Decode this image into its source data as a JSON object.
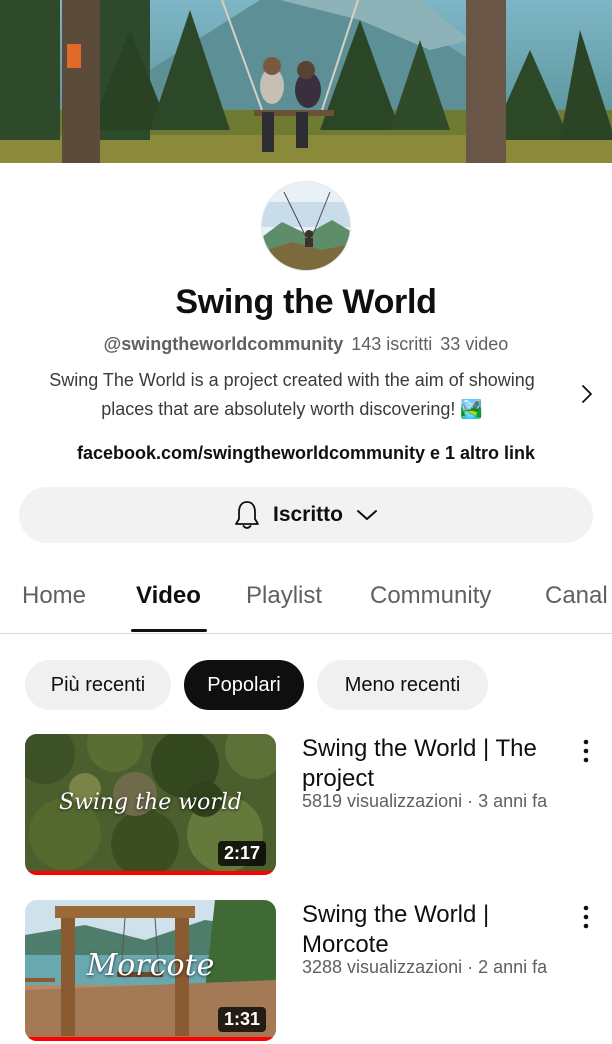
{
  "channel": {
    "name": "Swing the World",
    "handle": "@swingtheworldcommunity",
    "subscribers": "143 iscritti",
    "video_count": "33 video",
    "description_line1": "Swing The World is a project created with the aim of showing",
    "description_line2": "places that are absolutely worth discovering! 🏞️",
    "links": "facebook.com/swingtheworldcommunity e 1 altro link"
  },
  "subscribe_button": {
    "label": "Iscritto"
  },
  "tabs": [
    {
      "label": "Home"
    },
    {
      "label": "Video"
    },
    {
      "label": "Playlist"
    },
    {
      "label": "Community"
    },
    {
      "label": "Canal"
    }
  ],
  "active_tab": "Video",
  "chips": [
    {
      "label": "Più recenti"
    },
    {
      "label": "Popolari"
    },
    {
      "label": "Meno recenti"
    }
  ],
  "selected_chip": "Popolari",
  "videos": [
    {
      "title": "Swing the World | The project",
      "views": "5819 visualizzazioni",
      "age": "3 anni fa",
      "duration": "2:17",
      "thumb_text": "Swing the world",
      "watched_progress": 1.0
    },
    {
      "title": "Swing the World | Morcote",
      "views": "3288 visualizzazioni",
      "age": "2 anni fa",
      "duration": "1:31",
      "thumb_text": "Morcote",
      "watched_progress": 1.0
    }
  ],
  "icons": {
    "bell": "bell-icon",
    "chevron_down": "chevron-down-icon",
    "chevron_right": "chevron-right-icon",
    "more_vert": "more-vert-icon"
  },
  "colors": {
    "progress": "#ff0000",
    "chip_selected_bg": "#0f0f0f",
    "chip_bg": "#f0f0f0",
    "secondary_text": "#606060"
  }
}
